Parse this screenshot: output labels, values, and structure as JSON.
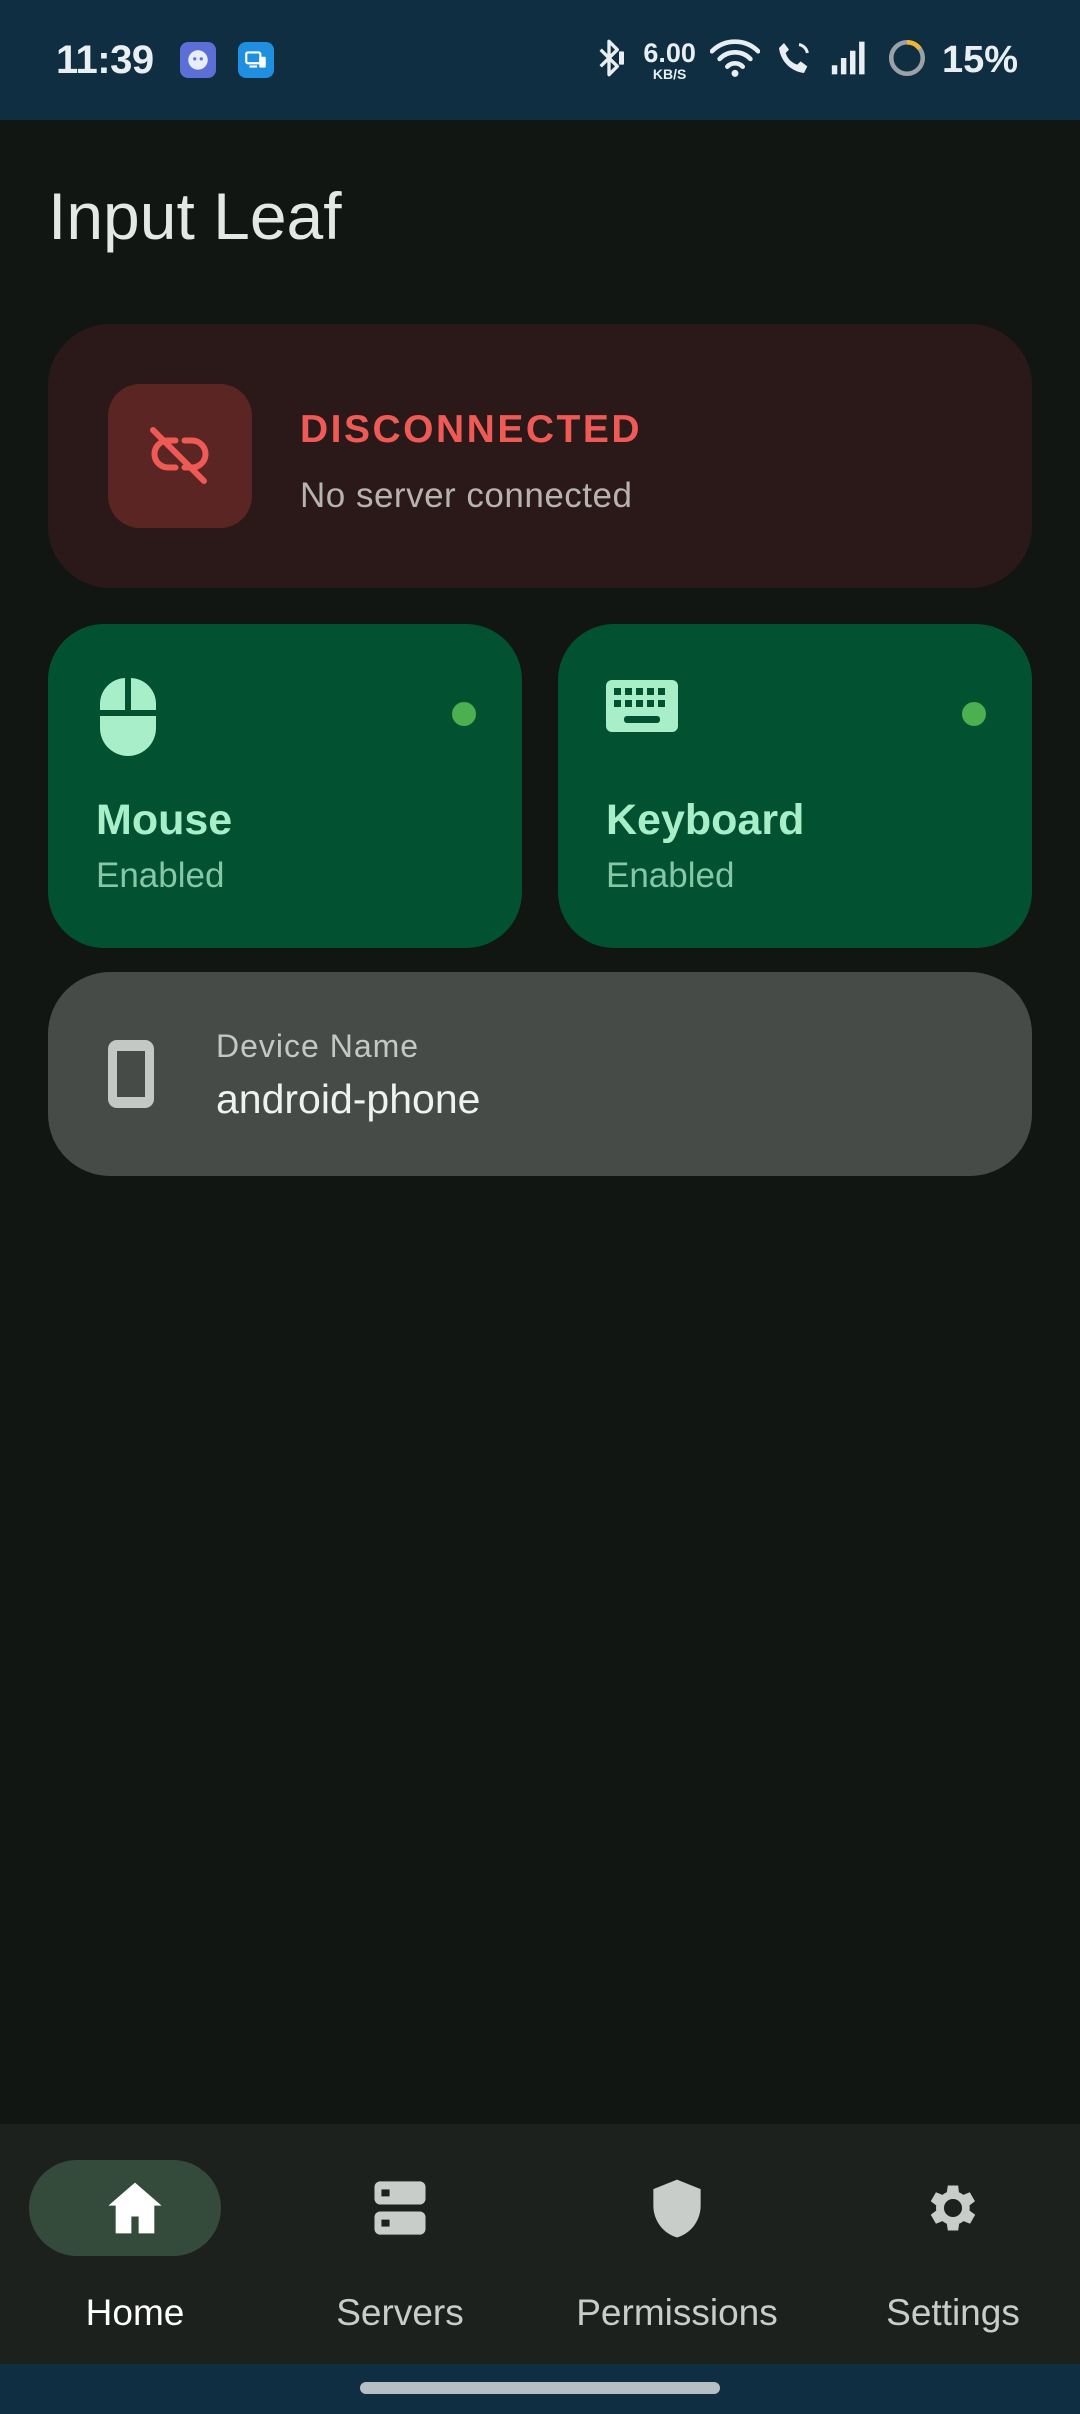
{
  "status_bar": {
    "time": "11:39",
    "net_speed_value": "6.00",
    "net_speed_unit": "KB/S",
    "battery": "15%"
  },
  "app": {
    "title": "Input Leaf"
  },
  "connection": {
    "status": "DISCONNECTED",
    "detail": "No server connected",
    "icon": "link-off-icon",
    "color": "#ee5a55"
  },
  "features": [
    {
      "label": "Mouse",
      "state": "Enabled",
      "icon": "mouse-icon",
      "indicator_color": "#4caf50"
    },
    {
      "label": "Keyboard",
      "state": "Enabled",
      "icon": "keyboard-icon",
      "indicator_color": "#4caf50"
    }
  ],
  "device": {
    "label": "Device Name",
    "value": "android-phone",
    "icon": "smartphone-icon"
  },
  "nav": {
    "items": [
      {
        "label": "Home",
        "icon": "home-icon",
        "active": true
      },
      {
        "label": "Servers",
        "icon": "servers-icon",
        "active": false
      },
      {
        "label": "Permissions",
        "icon": "shield-icon",
        "active": false
      },
      {
        "label": "Settings",
        "icon": "gear-icon",
        "active": false
      }
    ]
  }
}
